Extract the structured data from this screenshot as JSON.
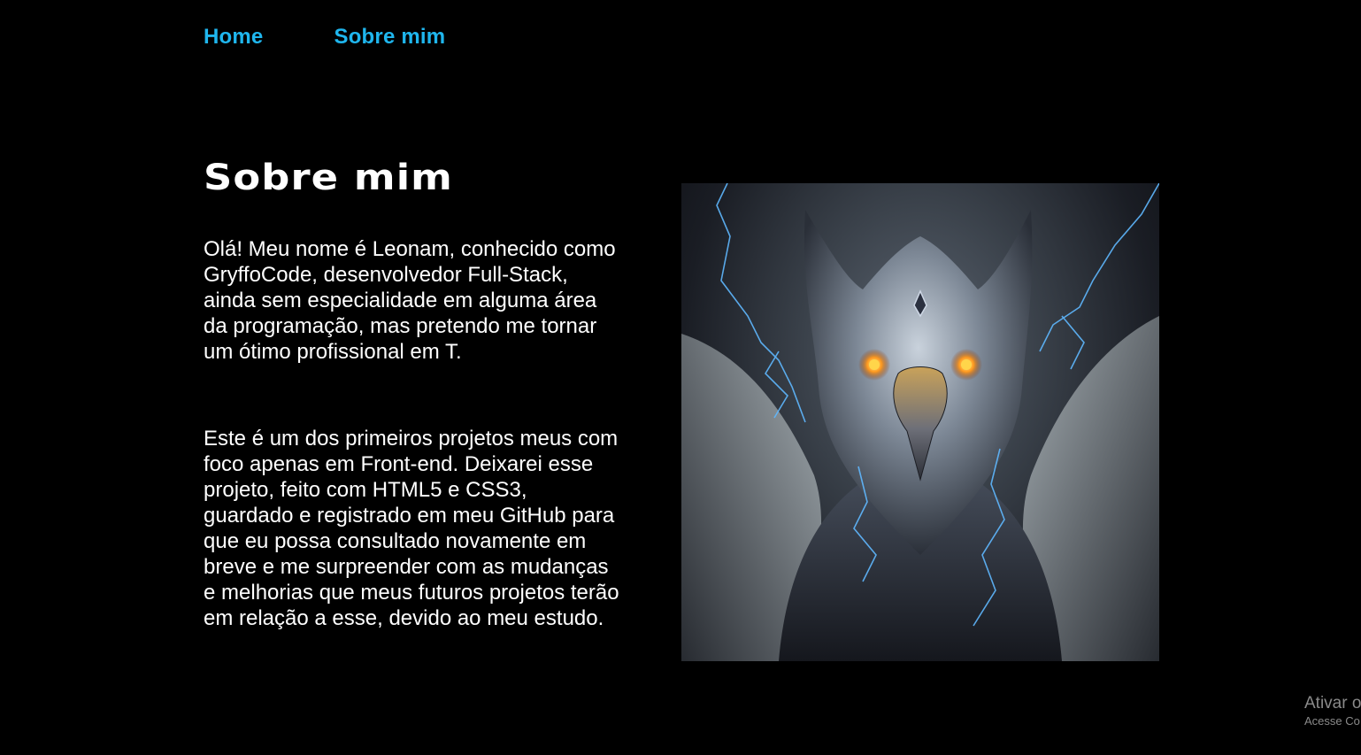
{
  "nav": {
    "items": [
      {
        "label": "Home"
      },
      {
        "label": "Sobre mim"
      }
    ]
  },
  "about": {
    "title": "Sobre mim",
    "paragraphs": [
      "Olá! Meu nome é Leonam, conhecido como GryffoCode, desenvolvedor Full-Stack, ainda sem especialidade em alguma área da programação, mas pretendo me tornar um ótimo profissional em T.",
      "Este é um dos primeiros projetos meus com foco apenas em Front-end. Deixarei esse projeto, feito com HTML5 e CSS3, guardado e registrado em meu GitHub para que eu possa consultado novamente em breve e me surpreender com as mudanças e melhorias que meus futuros projetos terão em relação a esse, devido ao meu estudo."
    ]
  },
  "image": {
    "icon": "gryphon-portrait"
  },
  "watermark": {
    "line1": "Ativar o",
    "line2": "Acesse Co"
  },
  "colors": {
    "background": "#000000",
    "nav_link": "#1fb6ee",
    "text": "#ffffff",
    "lightning": "#5fb8ff",
    "eyes": "#ff9a1f"
  }
}
